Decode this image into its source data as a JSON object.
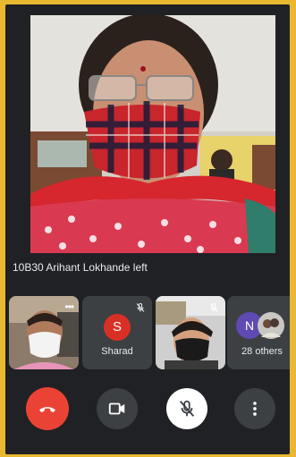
{
  "call": {
    "notification": "10B30 Arihant Lokhande left"
  },
  "participants": [
    {
      "name": "",
      "initial": "",
      "muted": false,
      "type": "self-video"
    },
    {
      "name": "Sharad",
      "initial": "S",
      "muted": true,
      "avatar_color": "#d93025"
    },
    {
      "name": "",
      "initial": "",
      "muted": true,
      "type": "video"
    },
    {
      "name": "28 others",
      "initial": "N",
      "muted": false,
      "avatar_color": "#5f4ab3"
    }
  ],
  "controls": {
    "end_call_icon": "phone-hangup-icon",
    "camera_icon": "video-camera-icon",
    "mic_icon": "mic-off-icon",
    "more_icon": "more-vert-icon"
  },
  "colors": {
    "end_call": "#ea4335",
    "control_bg": "#3c4043",
    "mic_button": "#ffffff",
    "background": "#202124"
  }
}
